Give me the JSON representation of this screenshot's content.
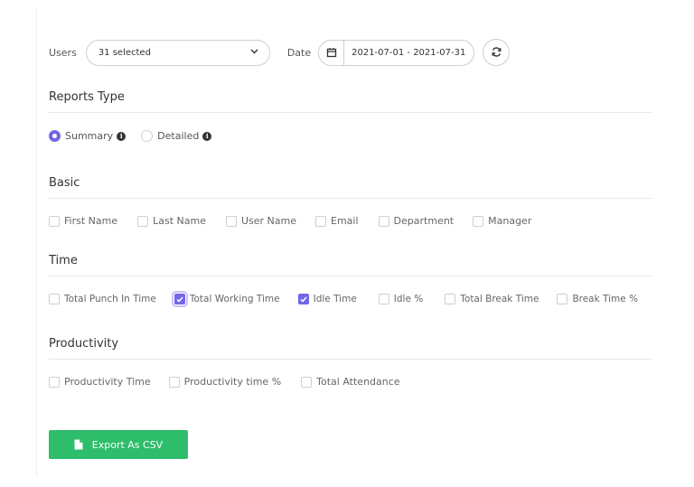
{
  "filters": {
    "users_label": "Users",
    "users_value": "31 selected",
    "date_label": "Date",
    "date_range": "2021-07-01 - 2021-07-31"
  },
  "reports_type": {
    "title": "Reports Type",
    "options": [
      {
        "label": "Summary",
        "selected": true
      },
      {
        "label": "Detailed",
        "selected": false
      }
    ]
  },
  "basic": {
    "title": "Basic",
    "fields": [
      {
        "label": "First Name",
        "checked": false
      },
      {
        "label": "Last Name",
        "checked": false
      },
      {
        "label": "User Name",
        "checked": false
      },
      {
        "label": "Email",
        "checked": false
      },
      {
        "label": "Department",
        "checked": false
      },
      {
        "label": "Manager",
        "checked": false
      }
    ]
  },
  "time": {
    "title": "Time",
    "fields": [
      {
        "label": "Total Punch In Time",
        "checked": false
      },
      {
        "label": "Total Working Time",
        "checked": true
      },
      {
        "label": "Idle Time",
        "checked": true
      },
      {
        "label": "Idle %",
        "checked": false
      },
      {
        "label": "Total Break Time",
        "checked": false
      },
      {
        "label": "Break Time %",
        "checked": false
      }
    ]
  },
  "productivity": {
    "title": "Productivity",
    "fields": [
      {
        "label": "Productivity Time",
        "checked": false
      },
      {
        "label": "Productivity time %",
        "checked": false
      },
      {
        "label": "Total Attendance",
        "checked": false
      }
    ]
  },
  "export_label": "Export As CSV",
  "colors": {
    "accent": "#7466e8",
    "export": "#2ebd6b"
  }
}
